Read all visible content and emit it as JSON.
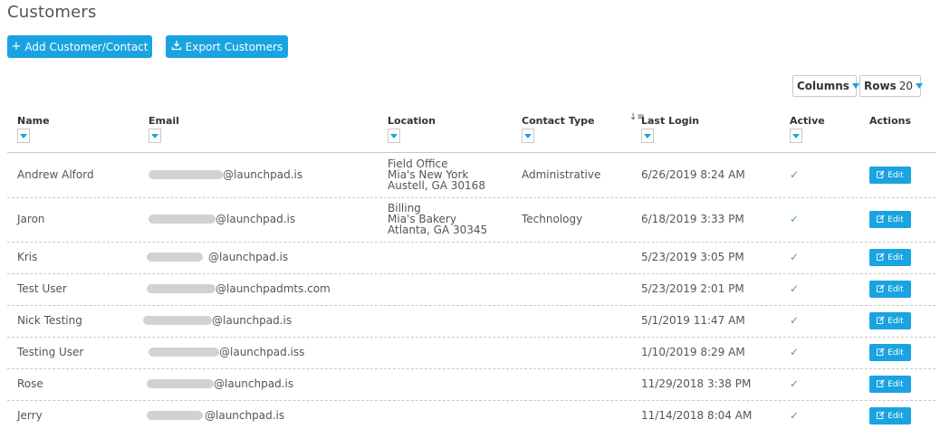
{
  "page": {
    "title": "Customers"
  },
  "toolbar": {
    "add_label": "Add Customer/Contact",
    "add_icon": "plus-icon",
    "export_label": "Export Customers",
    "export_icon": "export-icon"
  },
  "controls": {
    "columns_label": "Columns",
    "rows_label": "Rows",
    "rows_value": "20"
  },
  "table": {
    "headers": {
      "name": "Name",
      "email": "Email",
      "location": "Location",
      "contact_type": "Contact Type",
      "last_login": "Last Login",
      "active": "Active",
      "actions": "Actions"
    },
    "sort_icon": "sort-desc-icon",
    "edit_label": "Edit",
    "active_mark": "✓",
    "rows": [
      {
        "name": "Andrew Alford",
        "email": "@launchpad.is",
        "location": [
          "Field Office",
          "Mia's New York",
          "Austell, GA 30168"
        ],
        "contact_type": "Administrative",
        "last_login": "6/26/2019 8:24 AM"
      },
      {
        "name": "Jaron",
        "email": "@launchpad.is",
        "location": [
          "Billing",
          "Mia's Bakery",
          "Atlanta, GA 30345"
        ],
        "contact_type": "Technology",
        "last_login": "6/18/2019 3:33 PM"
      },
      {
        "name": "Kris",
        "email": "@launchpad.is",
        "location": [],
        "contact_type": "",
        "last_login": "5/23/2019 3:05 PM"
      },
      {
        "name": "Test User",
        "email": "@launchpadmts.com",
        "location": [],
        "contact_type": "",
        "last_login": "5/23/2019 2:01 PM"
      },
      {
        "name": "Nick Testing",
        "email": "@launchpad.is",
        "location": [],
        "contact_type": "",
        "last_login": "5/1/2019 11:47 AM"
      },
      {
        "name": "Testing User",
        "email": "@launchpad.iss",
        "location": [],
        "contact_type": "",
        "last_login": "1/10/2019 8:29 AM"
      },
      {
        "name": "Rose",
        "email": "@launchpad.is",
        "location": [],
        "contact_type": "",
        "last_login": "11/29/2018 3:38 PM"
      },
      {
        "name": "Jerry",
        "email": "@launchpad.is",
        "location": [],
        "contact_type": "",
        "last_login": "11/14/2018 8:04 AM"
      }
    ]
  },
  "colors": {
    "accent": "#1aa3e1",
    "check": "#4caf50"
  }
}
